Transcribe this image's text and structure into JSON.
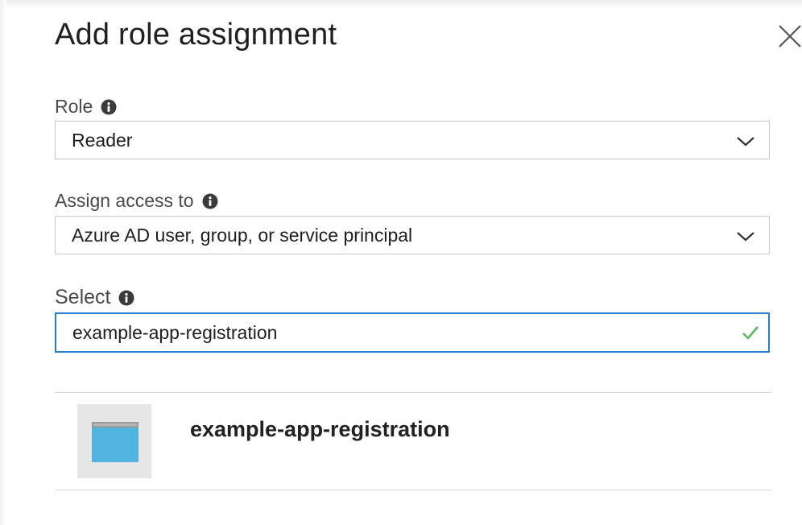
{
  "dialog": {
    "title": "Add role assignment",
    "close_icon": "close-icon"
  },
  "role": {
    "label": "Role",
    "value": "Reader",
    "info_icon": "info-icon",
    "dropdown_icon": "chevron-down-icon"
  },
  "assign_access": {
    "label": "Assign access to",
    "value": "Azure AD user, group, or service principal",
    "info_icon": "info-icon",
    "dropdown_icon": "chevron-down-icon"
  },
  "select": {
    "label": "Select",
    "value": "example-app-registration",
    "info_icon": "info-icon",
    "status_icon": "checkmark-icon",
    "status_color": "#5cb85c",
    "focus_color": "#2b7cd3"
  },
  "results": [
    {
      "name": "example-app-registration",
      "icon": "app-registration-icon",
      "icon_color": "#50b4de"
    }
  ]
}
